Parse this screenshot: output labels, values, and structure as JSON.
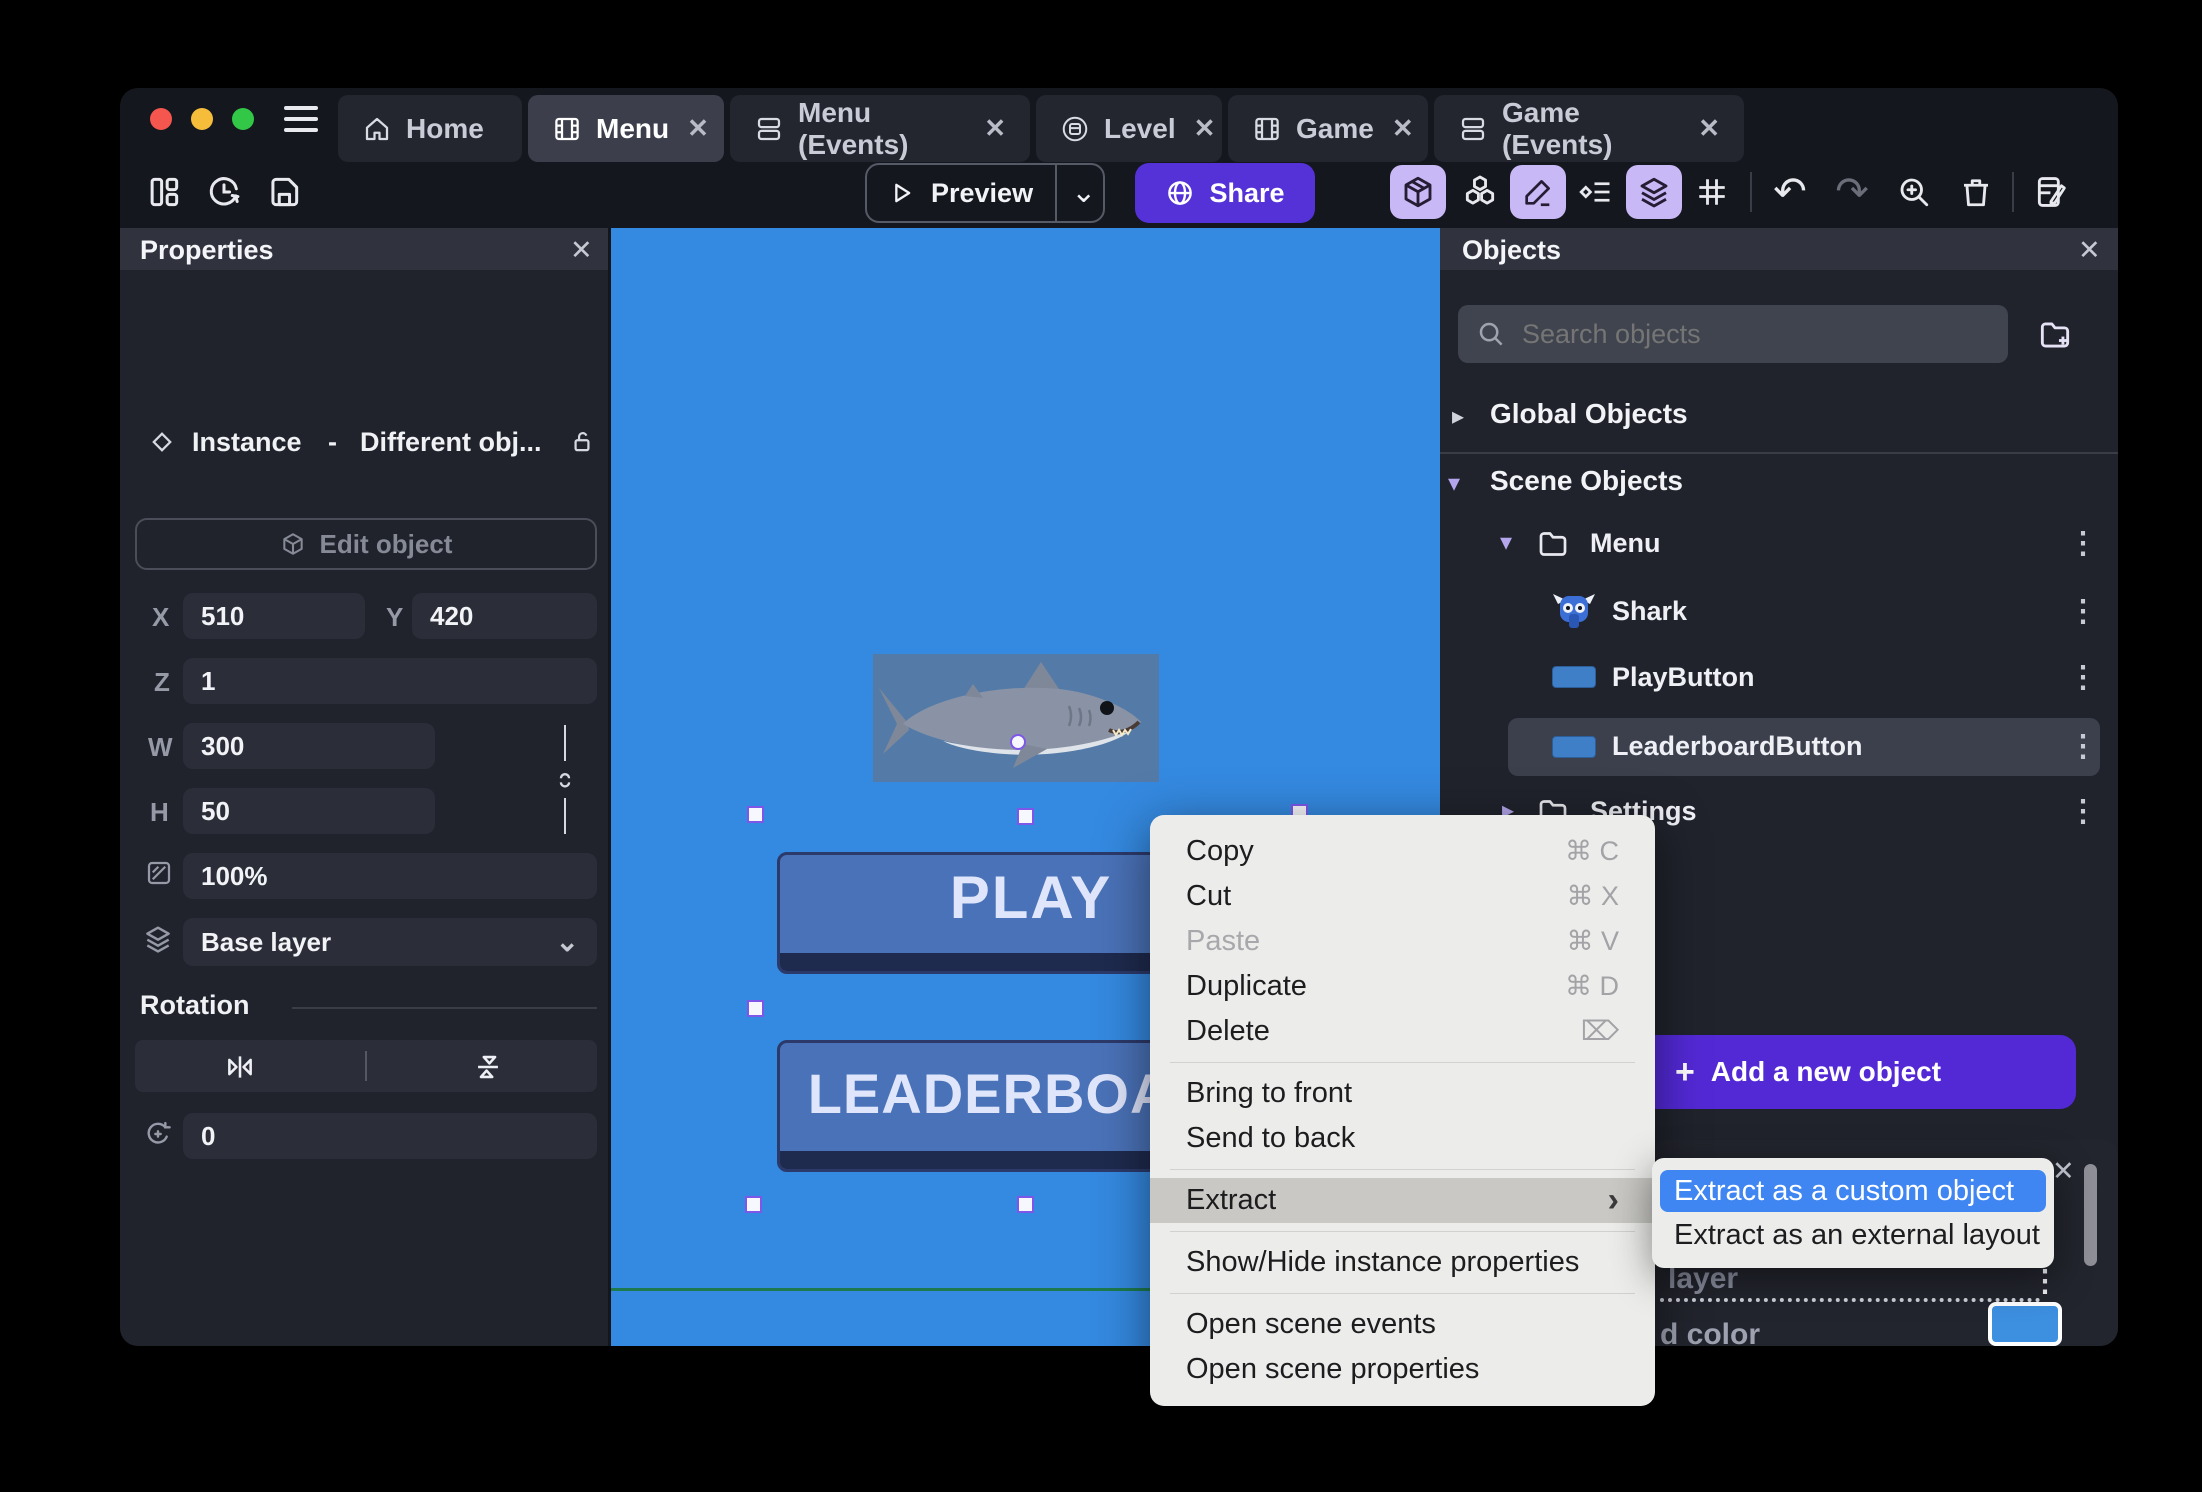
{
  "ui": {
    "close_glyph": "✕",
    "kebab_glyph": "⋮",
    "caret_right": "▸",
    "caret_down": "▾",
    "chevron_down": "⌄",
    "submenu_arrow": "›",
    "undo_glyph": "↶",
    "redo_glyph": "↷",
    "plus_glyph": "+",
    "accent_purple": "#5531d8",
    "active_icon_bg": "#c9b8f6"
  },
  "tab_bar": {
    "tabs": [
      {
        "label": "Home",
        "icon": "home-icon",
        "closable": false,
        "active": false
      },
      {
        "label": "Menu",
        "icon": "scene-icon",
        "closable": true,
        "active": true
      },
      {
        "label": "Menu (Events)",
        "icon": "events-icon",
        "closable": true,
        "active": false
      },
      {
        "label": "Level",
        "icon": "external-layout-icon",
        "closable": true,
        "active": false
      },
      {
        "label": "Game",
        "icon": "scene-icon",
        "closable": true,
        "active": false
      },
      {
        "label": "Game (Events)",
        "icon": "events-icon",
        "closable": true,
        "active": false
      }
    ]
  },
  "toolbar": {
    "preview_label": "Preview",
    "share_label": "Share",
    "left_icons": [
      "layout-icon",
      "history-icon",
      "save-icon"
    ],
    "right_icons": [
      "cube-3d-icon (active)",
      "objects-icon",
      "edit-pencil-icon (active)",
      "instance-properties-icon",
      "layers-icon (active)",
      "grid-icon",
      "undo-icon",
      "redo-icon (disabled)",
      "zoom-in-icon",
      "trash-icon",
      "scene-events-icon"
    ]
  },
  "properties_panel": {
    "title": "Properties",
    "instance_type": "Instance",
    "separator": "-",
    "instance_object": "Different obj...",
    "edit_object_label": "Edit object",
    "fields": {
      "x": {
        "label": "X",
        "value": "510"
      },
      "y": {
        "label": "Y",
        "value": "420"
      },
      "z": {
        "label": "Z",
        "value": "1"
      },
      "w": {
        "label": "W",
        "value": "300"
      },
      "h": {
        "label": "H",
        "value": "50"
      },
      "opacity": {
        "value": "100%"
      },
      "layer": {
        "value": "Base layer"
      }
    },
    "rotation": {
      "title": "Rotation",
      "value": "0"
    }
  },
  "canvas": {
    "background_color": "#3489e0",
    "scene_edge_color": "#1d7a4e",
    "play_button_label": "PLAY",
    "leaderboard_button_label": "LEADERBOARD",
    "button_fill_color": "#4a72b8"
  },
  "objects_panel": {
    "title": "Objects",
    "search_placeholder": "Search objects",
    "global_section": "Global Objects",
    "scene_section": "Scene Objects",
    "tree": [
      {
        "label": "Menu",
        "type": "folder",
        "expanded": true
      },
      {
        "label": "Shark",
        "type": "object"
      },
      {
        "label": "PlayButton",
        "type": "object"
      },
      {
        "label": "LeaderboardButton",
        "type": "object",
        "selected": true
      },
      {
        "label": "Settings",
        "type": "folder",
        "expanded": false
      }
    ],
    "add_button_label": "Add a new object"
  },
  "layers_panel": {
    "layer_text_fragment": "layer",
    "color_text_fragment": "d color",
    "swatch_color": "#3d8fe0"
  },
  "context_menu": {
    "items": [
      {
        "label": "Copy",
        "shortcut": "⌘ C"
      },
      {
        "label": "Cut",
        "shortcut": "⌘ X"
      },
      {
        "label": "Paste",
        "shortcut": "⌘ V",
        "disabled": true
      },
      {
        "label": "Duplicate",
        "shortcut": "⌘ D"
      },
      {
        "label": "Delete",
        "shortcut": "⌦"
      },
      {
        "label": "Bring to front"
      },
      {
        "label": "Send to back"
      },
      {
        "label": "Extract",
        "highlighted": true
      },
      {
        "label": "Show/Hide instance properties"
      },
      {
        "label": "Open scene events"
      },
      {
        "label": "Open scene properties"
      }
    ]
  },
  "extract_submenu": {
    "items": [
      {
        "label": "Extract as a custom object",
        "highlighted": true
      },
      {
        "label": "Extract as an external layout"
      }
    ]
  }
}
